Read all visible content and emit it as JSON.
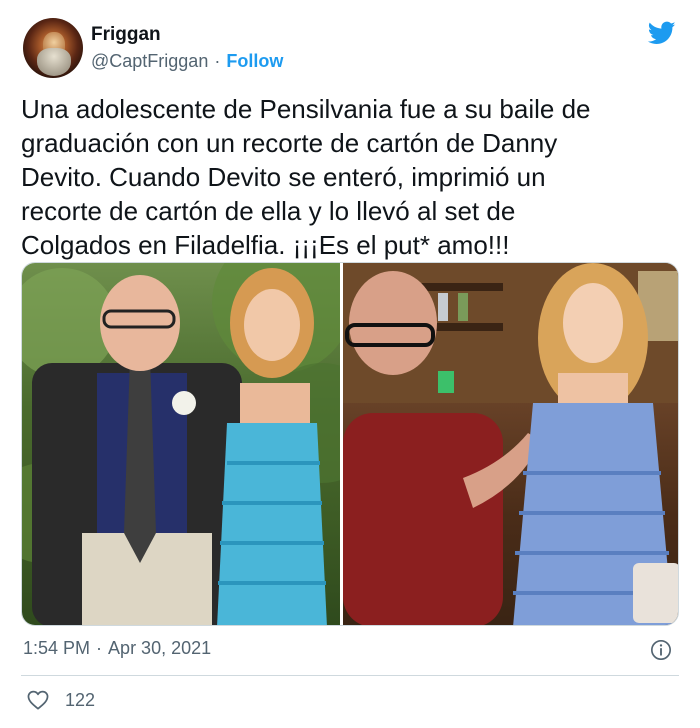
{
  "author": {
    "name": "Friggan",
    "handle": "@CaptFriggan",
    "separator": "·",
    "follow_label": "Follow"
  },
  "tweet": {
    "text": "Una adolescente de Pensilvania fue a su baile de\ngraduación con un recorte de cartón de Danny\nDevito. Cuando Devito se enteró, imprimió un\nrecorte de cartón de ella y lo llevó al set de\nColgados en Filadelfia. ¡¡¡Es el put* amo!!!"
  },
  "meta": {
    "time": "1:54 PM",
    "separator": "·",
    "date": "Apr 30, 2021"
  },
  "engagement": {
    "likes": "122"
  },
  "icons": {
    "brand": "twitter-bird-icon",
    "info": "info-icon",
    "like": "heart-icon"
  },
  "colors": {
    "accent": "#1d9bf0",
    "text": "#0f1419",
    "secondary": "#536471",
    "border": "#cfd9de"
  }
}
